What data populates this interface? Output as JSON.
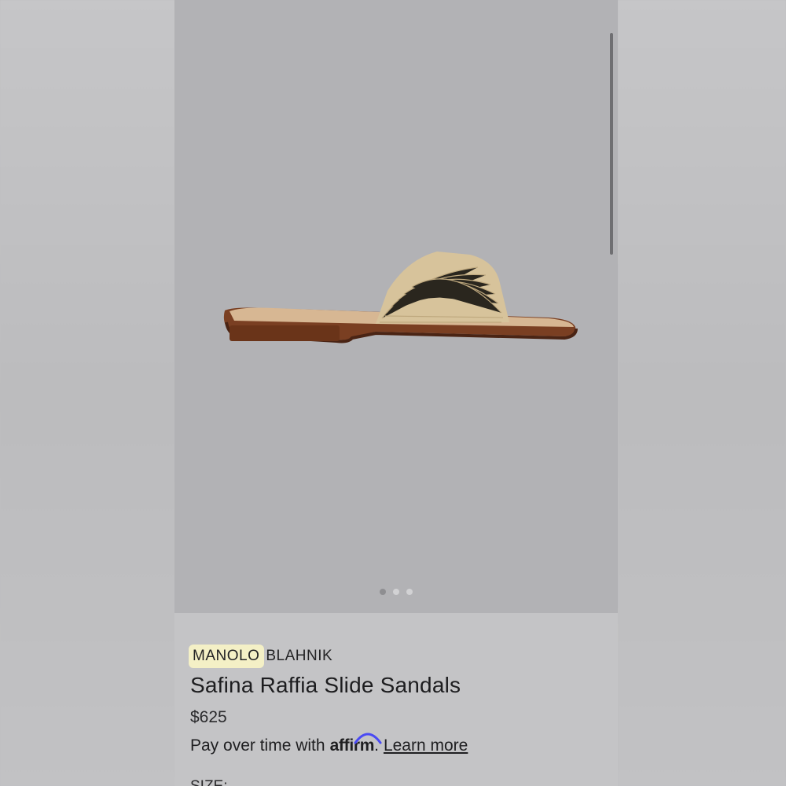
{
  "gallery": {
    "image_alt": "Safina raffia slide sandal product photo",
    "slide_count": 3,
    "active_slide": 1
  },
  "product": {
    "brand_highlight": "MANOLO",
    "brand_rest": "BLAHNIK",
    "title": "Safina Raffia Slide Sandals",
    "price": "$625"
  },
  "financing": {
    "prefix": "Pay over time with",
    "logo_text": "affirm",
    "suffix": ".",
    "link_label": "Learn more"
  },
  "size": {
    "label": "SIZE:"
  },
  "colors": {
    "highlight": "#f4f0c6",
    "affirm_arc": "#4a4af4"
  }
}
